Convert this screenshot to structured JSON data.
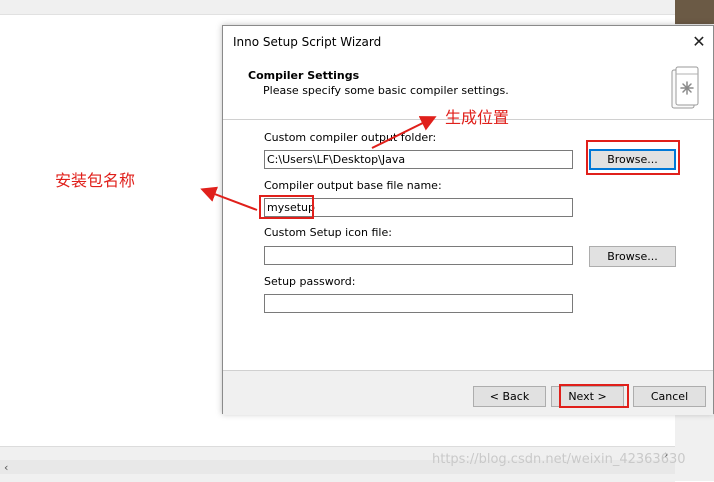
{
  "dialog": {
    "title": "Inno Setup Script Wizard",
    "close_glyph": "✕",
    "header_title": "Compiler Settings",
    "header_subtitle": "Please specify some basic compiler settings."
  },
  "form": {
    "output_folder_label": "Custom compiler output folder:",
    "output_folder_value": "C:\\Users\\LF\\Desktop\\Java",
    "browse_label": "Browse...",
    "base_name_label": "Compiler output base file name:",
    "base_name_value": "mysetup",
    "icon_label": "Custom Setup icon file:",
    "icon_value": "",
    "icon_browse_label": "Browse...",
    "password_label": "Setup password:",
    "password_value": ""
  },
  "footer": {
    "back_label": "< Back",
    "next_label": "Next >",
    "cancel_label": "Cancel"
  },
  "annotations": {
    "output_location": "生成位置",
    "package_name": "安装包名称",
    "color": "#e0201b"
  },
  "watermark": "https://blog.csdn.net/weixin_42363630"
}
